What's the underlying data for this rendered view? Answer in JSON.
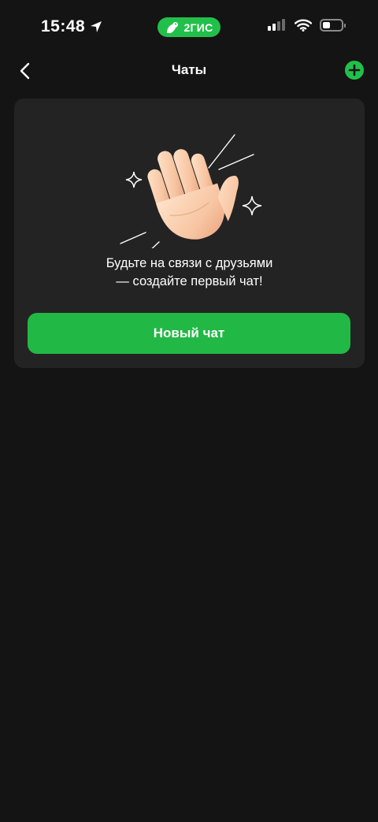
{
  "status_bar": {
    "time": "15:48",
    "brand": "2ГИС",
    "battery_level": 0.4,
    "icons": [
      "location-arrow-icon",
      "cellular-signal-icon",
      "wifi-icon",
      "battery-icon"
    ]
  },
  "nav": {
    "title": "Чаты",
    "back_icon": "chevron-left-icon",
    "add_icon": "plus-circle-icon"
  },
  "empty_state": {
    "illustration": "waving-hand",
    "message_line1": "Будьте на связи с друзьями",
    "message_line2": "— создайте первый чат!",
    "button_label": "Новый чат"
  },
  "colors": {
    "background": "#141414",
    "card": "#232323",
    "accent": "#22b845"
  }
}
